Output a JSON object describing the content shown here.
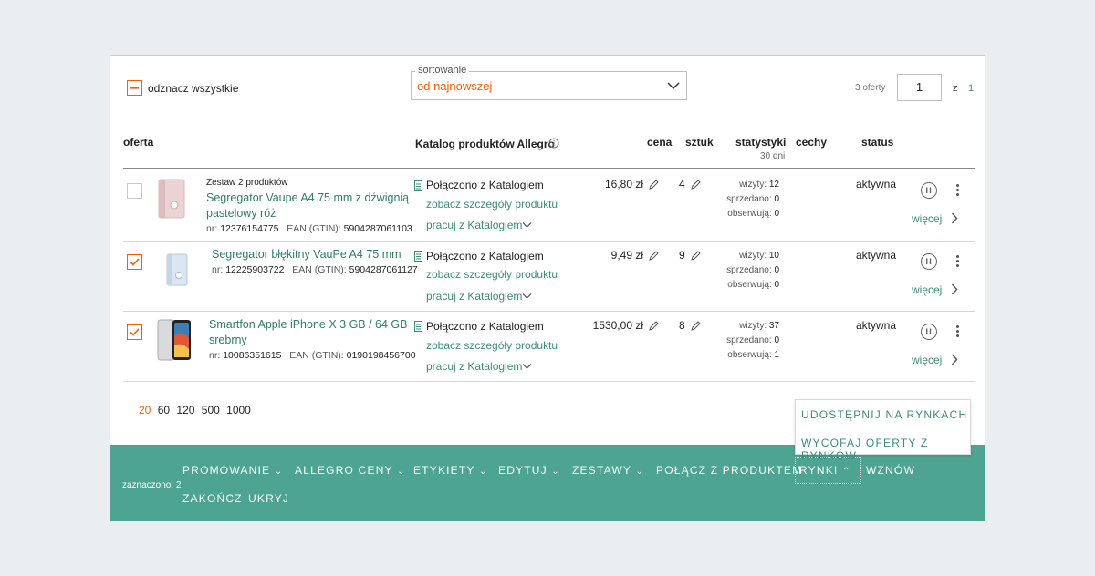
{
  "top": {
    "select_all_label": "odznacz wszystkie",
    "sort_legend": "sortowanie",
    "sort_value": "od najnowszej",
    "offers_count": "3 oferty",
    "page_value": "1",
    "page_of": "z",
    "page_total": "1"
  },
  "columns": {
    "offer": "oferta",
    "catalog": "Katalog produktów Allegro",
    "price": "cena",
    "qty": "sztuk",
    "stats": "statystyki",
    "stats_sub": "30 dni",
    "features": "cechy",
    "status": "status"
  },
  "rows": [
    {
      "checked": false,
      "bundle_label": "Zestaw 2 produktów",
      "title_line1": "Segregator Vaupe A4 75 mm z dźwignią",
      "title_line2": "pastelowy róż",
      "nr_label": "nr:",
      "nr": "12376154775",
      "ean_label": "EAN (GTIN):",
      "ean": "5904287061103",
      "catalog_status": "Połączono z Katalogiem",
      "catalog_details": "zobacz szczegóły produktu",
      "catalog_work": "pracuj z Katalogiem",
      "price": "16,80 zł",
      "qty": "4",
      "visits_label": "wizyty:",
      "visits": "12",
      "sold_label": "sprzedano:",
      "sold": "0",
      "watch_label": "obserwują:",
      "watch": "0",
      "status": "aktywna",
      "more": "więcej"
    },
    {
      "checked": true,
      "title_line1": "Segregator błękitny VauPe A4 75 mm",
      "nr_label": "nr:",
      "nr": "12225903722",
      "ean_label": "EAN (GTIN):",
      "ean": "5904287061127",
      "catalog_status": "Połączono z Katalogiem",
      "catalog_details": "zobacz szczegóły produktu",
      "catalog_work": "pracuj z Katalogiem",
      "price": "9,49 zł",
      "qty": "9",
      "visits_label": "wizyty:",
      "visits": "10",
      "sold_label": "sprzedano:",
      "sold": "0",
      "watch_label": "obserwują:",
      "watch": "0",
      "status": "aktywna",
      "more": "więcej"
    },
    {
      "checked": true,
      "title_line1": "Smartfon Apple iPhone X 3 GB / 64 GB",
      "title_line2": "srebrny",
      "nr_label": "nr:",
      "nr": "10086351615",
      "ean_label": "EAN (GTIN):",
      "ean": "0190198456700",
      "catalog_status": "Połączono z Katalogiem",
      "catalog_details": "zobacz szczegóły produktu",
      "catalog_work": "pracuj z Katalogiem",
      "price": "1530,00 zł",
      "qty": "8",
      "visits_label": "wizyty:",
      "visits": "37",
      "sold_label": "sprzedano:",
      "sold": "0",
      "watch_label": "obserwują:",
      "watch": "1",
      "status": "aktywna",
      "more": "więcej"
    }
  ],
  "page_sizes": [
    "20",
    "60",
    "120",
    "500",
    "1000"
  ],
  "page_size_selected": "20",
  "dropdown": {
    "share": "UDOSTĘPNIJ NA RYNKACH",
    "withdraw": "WYCOFAJ OFERTY Z RYNKÓW"
  },
  "footer": {
    "selected": "zaznaczono: 2",
    "promote": "PROMOWANIE",
    "allegro_prices": "ALLEGRO CENY",
    "labels": "ETYKIETY",
    "edit": "EDYTUJ",
    "bundles": "ZESTAWY",
    "connect": "POŁĄCZ Z PRODUKTEM",
    "markets": "RYNKI",
    "resume": "WZNÓW",
    "finish": "ZAKOŃCZ",
    "hide": "UKRYJ"
  },
  "colors": {
    "accent": "#ff5a00",
    "green_link": "#3a8d7a",
    "footer_bg": "#4ea492"
  }
}
